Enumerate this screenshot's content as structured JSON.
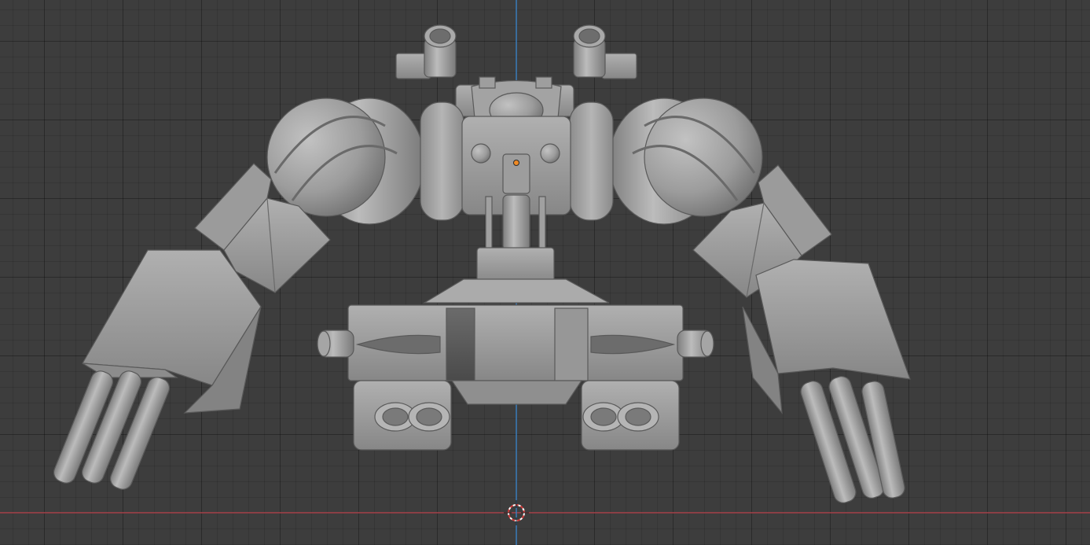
{
  "viewport": {
    "background_color": "#3d3d3d",
    "grid": true,
    "axis_colors": {
      "x_axis": "#a8434b",
      "z_axis": "#3d7ebd"
    },
    "model_color": "#9a9a9a"
  },
  "scene": {
    "model": "mech-robot-mesh",
    "cursor": "3d-cursor",
    "origin": "object-origin"
  }
}
